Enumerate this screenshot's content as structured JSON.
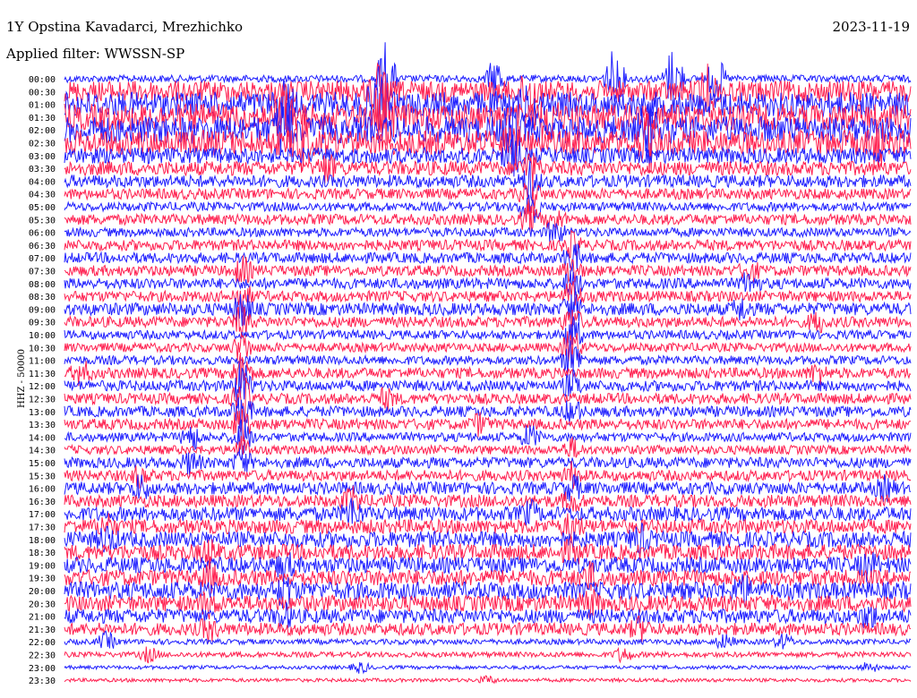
{
  "header": {
    "station": "1Y Opstina Kavadarci, Mrezhichko",
    "date": "2023-11-19",
    "filter": "Applied filter: WWSSN-SP"
  },
  "chart_data": {
    "type": "line",
    "title": "1Y Opstina Kavadarci, Mrezhichko",
    "ylabel": "HHZ - 50000",
    "channel": "HHZ",
    "scale": 50000,
    "x_range_minutes": [
      0,
      30
    ],
    "colors": {
      "even_rows": "#1f1fff",
      "odd_rows": "#ff2050"
    },
    "rows": [
      {
        "label": "00:00",
        "amplitude": 4,
        "events": [
          {
            "t": 0.38,
            "a": 45
          },
          {
            "t": 0.51,
            "a": 25
          },
          {
            "t": 0.65,
            "a": 35
          },
          {
            "t": 0.72,
            "a": 40
          },
          {
            "t": 0.77,
            "a": 25
          }
        ]
      },
      {
        "label": "00:30",
        "amplitude": 12,
        "events": [
          {
            "t": 0.37,
            "a": 22
          },
          {
            "t": 0.55,
            "a": 18
          },
          {
            "t": 0.76,
            "a": 20
          }
        ]
      },
      {
        "label": "01:00",
        "amplitude": 14,
        "events": [
          {
            "t": 0.26,
            "a": 20
          },
          {
            "t": 0.37,
            "a": 25
          },
          {
            "t": 0.55,
            "a": 20
          }
        ]
      },
      {
        "label": "01:30",
        "amplitude": 15,
        "events": [
          {
            "t": 0.26,
            "a": 28
          },
          {
            "t": 0.38,
            "a": 30
          },
          {
            "t": 0.57,
            "a": 24
          }
        ]
      },
      {
        "label": "02:00",
        "amplitude": 15,
        "events": [
          {
            "t": 0.26,
            "a": 30
          },
          {
            "t": 0.53,
            "a": 24
          },
          {
            "t": 0.69,
            "a": 22
          }
        ]
      },
      {
        "label": "02:30",
        "amplitude": 14,
        "events": [
          {
            "t": 0.28,
            "a": 28
          },
          {
            "t": 0.53,
            "a": 22
          },
          {
            "t": 0.69,
            "a": 24
          },
          {
            "t": 0.96,
            "a": 20
          }
        ]
      },
      {
        "label": "03:00",
        "amplitude": 9,
        "events": [
          {
            "t": 0.53,
            "a": 18
          }
        ]
      },
      {
        "label": "03:30",
        "amplitude": 8,
        "events": [
          {
            "t": 0.31,
            "a": 14
          },
          {
            "t": 0.55,
            "a": 16
          }
        ]
      },
      {
        "label": "04:00",
        "amplitude": 7,
        "events": [
          {
            "t": 0.55,
            "a": 18
          }
        ]
      },
      {
        "label": "04:30",
        "amplitude": 6,
        "events": [
          {
            "t": 0.55,
            "a": 20
          }
        ]
      },
      {
        "label": "05:00",
        "amplitude": 5,
        "events": [
          {
            "t": 0.55,
            "a": 22
          }
        ]
      },
      {
        "label": "05:30",
        "amplitude": 6,
        "events": [
          {
            "t": 0.55,
            "a": 14
          },
          {
            "t": 0.58,
            "a": 10
          }
        ]
      },
      {
        "label": "06:00",
        "amplitude": 5,
        "events": [
          {
            "t": 0.58,
            "a": 12
          }
        ]
      },
      {
        "label": "06:30",
        "amplitude": 6,
        "events": [
          {
            "t": 0.6,
            "a": 12
          }
        ]
      },
      {
        "label": "07:00",
        "amplitude": 6,
        "events": [
          {
            "t": 0.6,
            "a": 16
          }
        ]
      },
      {
        "label": "07:30",
        "amplitude": 6,
        "events": [
          {
            "t": 0.21,
            "a": 14
          },
          {
            "t": 0.6,
            "a": 14
          },
          {
            "t": 0.81,
            "a": 10
          }
        ]
      },
      {
        "label": "08:00",
        "amplitude": 6,
        "events": [
          {
            "t": 0.6,
            "a": 14
          },
          {
            "t": 0.81,
            "a": 12
          }
        ]
      },
      {
        "label": "08:30",
        "amplitude": 6,
        "events": [
          {
            "t": 0.21,
            "a": 14
          },
          {
            "t": 0.6,
            "a": 16
          }
        ]
      },
      {
        "label": "09:00",
        "amplitude": 7,
        "events": [
          {
            "t": 0.21,
            "a": 18
          },
          {
            "t": 0.6,
            "a": 18
          },
          {
            "t": 0.8,
            "a": 10
          }
        ]
      },
      {
        "label": "09:30",
        "amplitude": 6,
        "events": [
          {
            "t": 0.21,
            "a": 16
          },
          {
            "t": 0.6,
            "a": 16
          },
          {
            "t": 0.89,
            "a": 10
          }
        ]
      },
      {
        "label": "10:00",
        "amplitude": 5,
        "events": [
          {
            "t": 0.6,
            "a": 20
          }
        ]
      },
      {
        "label": "10:30",
        "amplitude": 5,
        "events": [
          {
            "t": 0.21,
            "a": 16
          },
          {
            "t": 0.6,
            "a": 22
          }
        ]
      },
      {
        "label": "11:00",
        "amplitude": 5,
        "events": [
          {
            "t": 0.6,
            "a": 24
          }
        ]
      },
      {
        "label": "11:30",
        "amplitude": 6,
        "events": [
          {
            "t": 0.02,
            "a": 12
          },
          {
            "t": 0.21,
            "a": 22
          },
          {
            "t": 0.89,
            "a": 10
          }
        ]
      },
      {
        "label": "12:00",
        "amplitude": 6,
        "events": [
          {
            "t": 0.21,
            "a": 26
          },
          {
            "t": 0.6,
            "a": 14
          }
        ]
      },
      {
        "label": "12:30",
        "amplitude": 6,
        "events": [
          {
            "t": 0.21,
            "a": 26
          },
          {
            "t": 0.38,
            "a": 10
          }
        ]
      },
      {
        "label": "13:00",
        "amplitude": 6,
        "events": [
          {
            "t": 0.21,
            "a": 20
          },
          {
            "t": 0.6,
            "a": 12
          }
        ]
      },
      {
        "label": "13:30",
        "amplitude": 6,
        "events": [
          {
            "t": 0.21,
            "a": 20
          },
          {
            "t": 0.49,
            "a": 10
          }
        ]
      },
      {
        "label": "14:00",
        "amplitude": 5,
        "events": [
          {
            "t": 0.15,
            "a": 14
          },
          {
            "t": 0.21,
            "a": 22
          },
          {
            "t": 0.55,
            "a": 12
          }
        ]
      },
      {
        "label": "14:30",
        "amplitude": 5,
        "events": [
          {
            "t": 0.21,
            "a": 12
          },
          {
            "t": 0.6,
            "a": 10
          }
        ]
      },
      {
        "label": "15:00",
        "amplitude": 6,
        "events": [
          {
            "t": 0.15,
            "a": 12
          },
          {
            "t": 0.21,
            "a": 12
          }
        ]
      },
      {
        "label": "15:30",
        "amplitude": 6,
        "events": [
          {
            "t": 0.09,
            "a": 10
          },
          {
            "t": 0.6,
            "a": 12
          }
        ]
      },
      {
        "label": "16:00",
        "amplitude": 7,
        "events": [
          {
            "t": 0.09,
            "a": 12
          },
          {
            "t": 0.6,
            "a": 12
          },
          {
            "t": 0.97,
            "a": 10
          }
        ]
      },
      {
        "label": "16:30",
        "amplitude": 7,
        "events": [
          {
            "t": 0.34,
            "a": 12
          },
          {
            "t": 0.6,
            "a": 10
          }
        ]
      },
      {
        "label": "17:00",
        "amplitude": 8,
        "events": [
          {
            "t": 0.34,
            "a": 14
          },
          {
            "t": 0.55,
            "a": 10
          }
        ]
      },
      {
        "label": "17:30",
        "amplitude": 8,
        "events": [
          {
            "t": 0.05,
            "a": 10
          },
          {
            "t": 0.6,
            "a": 12
          }
        ]
      },
      {
        "label": "18:00",
        "amplitude": 9,
        "events": [
          {
            "t": 0.05,
            "a": 12
          },
          {
            "t": 0.68,
            "a": 12
          }
        ]
      },
      {
        "label": "18:30",
        "amplitude": 9,
        "events": [
          {
            "t": 0.17,
            "a": 10
          },
          {
            "t": 0.6,
            "a": 10
          }
        ]
      },
      {
        "label": "19:00",
        "amplitude": 9,
        "events": [
          {
            "t": 0.26,
            "a": 10
          },
          {
            "t": 0.95,
            "a": 12
          }
        ]
      },
      {
        "label": "19:30",
        "amplitude": 9,
        "events": [
          {
            "t": 0.17,
            "a": 12
          },
          {
            "t": 0.62,
            "a": 12
          }
        ]
      },
      {
        "label": "20:00",
        "amplitude": 10,
        "events": [
          {
            "t": 0.26,
            "a": 14
          },
          {
            "t": 0.8,
            "a": 14
          }
        ]
      },
      {
        "label": "20:30",
        "amplitude": 9,
        "events": [
          {
            "t": 0.17,
            "a": 10
          },
          {
            "t": 0.62,
            "a": 12
          }
        ]
      },
      {
        "label": "21:00",
        "amplitude": 8,
        "events": [
          {
            "t": 0.26,
            "a": 10
          },
          {
            "t": 0.95,
            "a": 10
          }
        ]
      },
      {
        "label": "21:30",
        "amplitude": 7,
        "events": [
          {
            "t": 0.17,
            "a": 10
          },
          {
            "t": 0.68,
            "a": 10
          }
        ]
      },
      {
        "label": "22:00",
        "amplitude": 3,
        "events": [
          {
            "t": 0.05,
            "a": 10
          },
          {
            "t": 0.78,
            "a": 8
          },
          {
            "t": 0.85,
            "a": 8
          }
        ]
      },
      {
        "label": "22:30",
        "amplitude": 3,
        "events": [
          {
            "t": 0.1,
            "a": 8
          },
          {
            "t": 0.66,
            "a": 8
          }
        ]
      },
      {
        "label": "23:00",
        "amplitude": 2,
        "events": [
          {
            "t": 0.35,
            "a": 6
          },
          {
            "t": 0.95,
            "a": 6
          }
        ]
      },
      {
        "label": "23:30",
        "amplitude": 2,
        "events": [
          {
            "t": 0.5,
            "a": 4
          }
        ]
      }
    ]
  }
}
